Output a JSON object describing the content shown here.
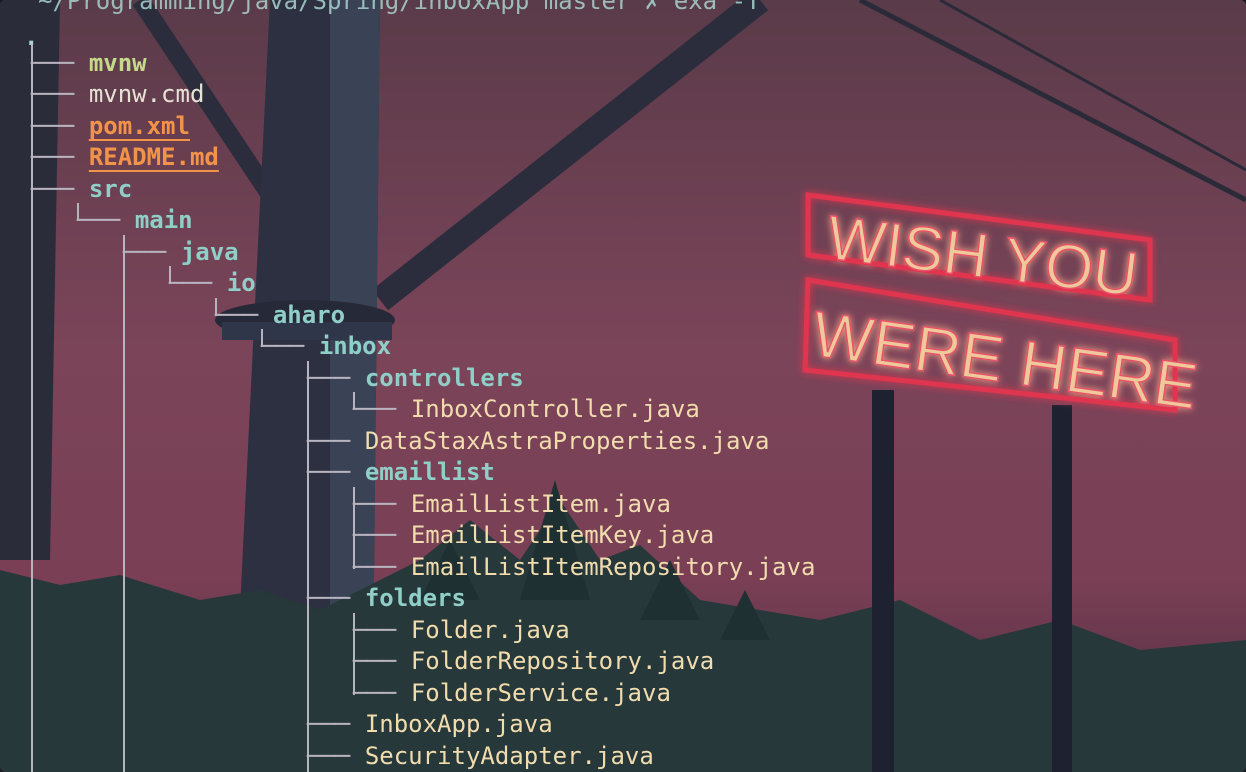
{
  "prompt": {
    "text": "~/Programming/java/Spring/inboxApp master ✗ exa -T"
  },
  "wallpaper": {
    "sign_line_1": "WISH YOU",
    "sign_line_2": "WERE HERE"
  },
  "tree": {
    "root": ".",
    "items": [
      {
        "connector": "├──",
        "name": "mvnw",
        "type": "exec"
      },
      {
        "connector": "├──",
        "name": "mvnw.cmd",
        "type": "file"
      },
      {
        "connector": "├──",
        "name": "pom.xml",
        "type": "highlight"
      },
      {
        "connector": "├──",
        "name": "README.md",
        "type": "highlight"
      },
      {
        "connector": "└──",
        "name": "src",
        "type": "dir"
      },
      {
        "connector": "└──",
        "name": "main",
        "type": "dir"
      },
      {
        "connector": "├──",
        "name": "java",
        "type": "dir"
      },
      {
        "connector": "└──",
        "name": "io",
        "type": "dir"
      },
      {
        "connector": "└──",
        "name": "aharo",
        "type": "dir"
      },
      {
        "connector": "└──",
        "name": "inbox",
        "type": "dir"
      },
      {
        "connector": "├──",
        "name": "controllers",
        "type": "dir"
      },
      {
        "connector": "└──",
        "name": "InboxController.java",
        "type": "java"
      },
      {
        "connector": "├──",
        "name": "DataStaxAstraProperties.java",
        "type": "java"
      },
      {
        "connector": "├──",
        "name": "emaillist",
        "type": "dir"
      },
      {
        "connector": "├──",
        "name": "EmailListItem.java",
        "type": "java"
      },
      {
        "connector": "├──",
        "name": "EmailListItemKey.java",
        "type": "java"
      },
      {
        "connector": "└──",
        "name": "EmailListItemRepository.java",
        "type": "java"
      },
      {
        "connector": "├──",
        "name": "folders",
        "type": "dir"
      },
      {
        "connector": "├──",
        "name": "Folder.java",
        "type": "java"
      },
      {
        "connector": "├──",
        "name": "FolderRepository.java",
        "type": "java"
      },
      {
        "connector": "└──",
        "name": "FolderService.java",
        "type": "java"
      },
      {
        "connector": "├──",
        "name": "InboxApp.java",
        "type": "java"
      },
      {
        "connector": "├──",
        "name": "SecurityAdapter.java",
        "type": "java"
      }
    ]
  }
}
